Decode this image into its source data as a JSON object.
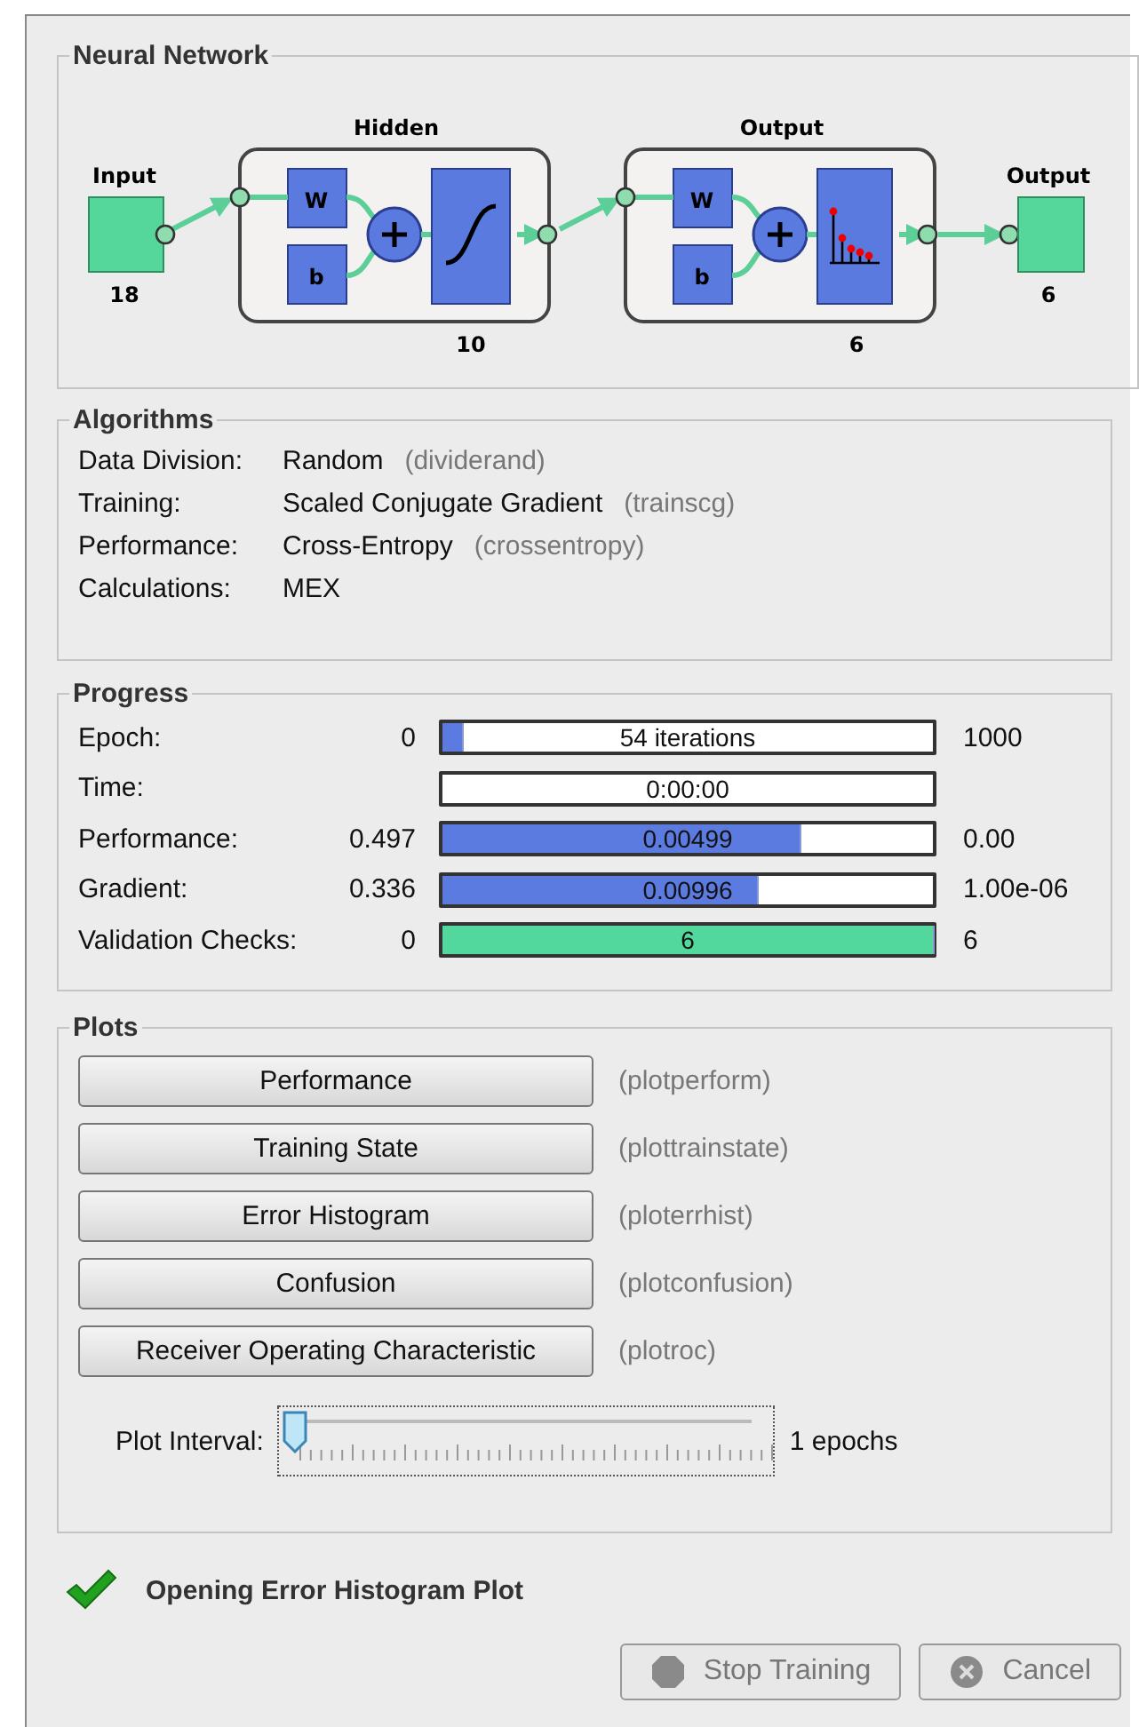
{
  "network": {
    "title": "Neural Network",
    "input": {
      "label": "Input",
      "size": "18"
    },
    "layers": [
      {
        "title": "Hidden",
        "weight": "W",
        "bias": "b",
        "kind": "sigmoid",
        "size": "10"
      },
      {
        "title": "Output",
        "weight": "W",
        "bias": "b",
        "kind": "softmax",
        "size": "6"
      }
    ],
    "output": {
      "label": "Output",
      "size": "6"
    }
  },
  "algorithms": {
    "title": "Algorithms",
    "rows": [
      {
        "label": "Data Division:",
        "value": "Random",
        "function": "(dividerand)"
      },
      {
        "label": "Training:",
        "value": "Scaled Conjugate Gradient",
        "function": "(trainscg)"
      },
      {
        "label": "Performance:",
        "value": "Cross-Entropy",
        "function": "(crossentropy)"
      },
      {
        "label": "Calculations:",
        "value": "MEX"
      }
    ]
  },
  "progress": {
    "title": "Progress",
    "rows": [
      {
        "label": "Epoch:",
        "start": "0",
        "reading": "54 iterations",
        "end": "1000",
        "level": 0.04,
        "color": "#5b7be0"
      },
      {
        "label": "Time:",
        "reading": "0:00:00"
      },
      {
        "label": "Performance:",
        "start": "0.497",
        "reading": "0.00499",
        "end": "0.00",
        "level": 0.73,
        "color": "#5b7be0"
      },
      {
        "label": "Gradient:",
        "start": "0.336",
        "reading": "0.00996",
        "end": "1.00e-06",
        "level": 0.64,
        "color": "#5b7be0"
      },
      {
        "label": "Validation Checks:",
        "start": "0",
        "reading": "6",
        "end": "6",
        "level": 1,
        "color": "#52d89c"
      }
    ]
  },
  "plots": {
    "title": "Plots",
    "buttons": [
      {
        "label": "Performance",
        "function": "(plotperform)"
      },
      {
        "label": "Training State",
        "function": "(plottrainstate)"
      },
      {
        "label": "Error Histogram",
        "function": "(ploterrhist)"
      },
      {
        "label": "Confusion",
        "function": "(plotconfusion)"
      },
      {
        "label": "Receiver Operating Characteristic",
        "function": "(plotroc)"
      }
    ],
    "interval": {
      "label": "Plot Interval:",
      "level": 0,
      "reading": "1 epochs"
    }
  },
  "status": {
    "message": "Opening Error Histogram Plot"
  },
  "buttons": [
    {
      "label": "Stop Training",
      "kind": "stop",
      "disabled": true
    },
    {
      "label": "Cancel",
      "kind": "cancel",
      "disabled": true
    }
  ]
}
